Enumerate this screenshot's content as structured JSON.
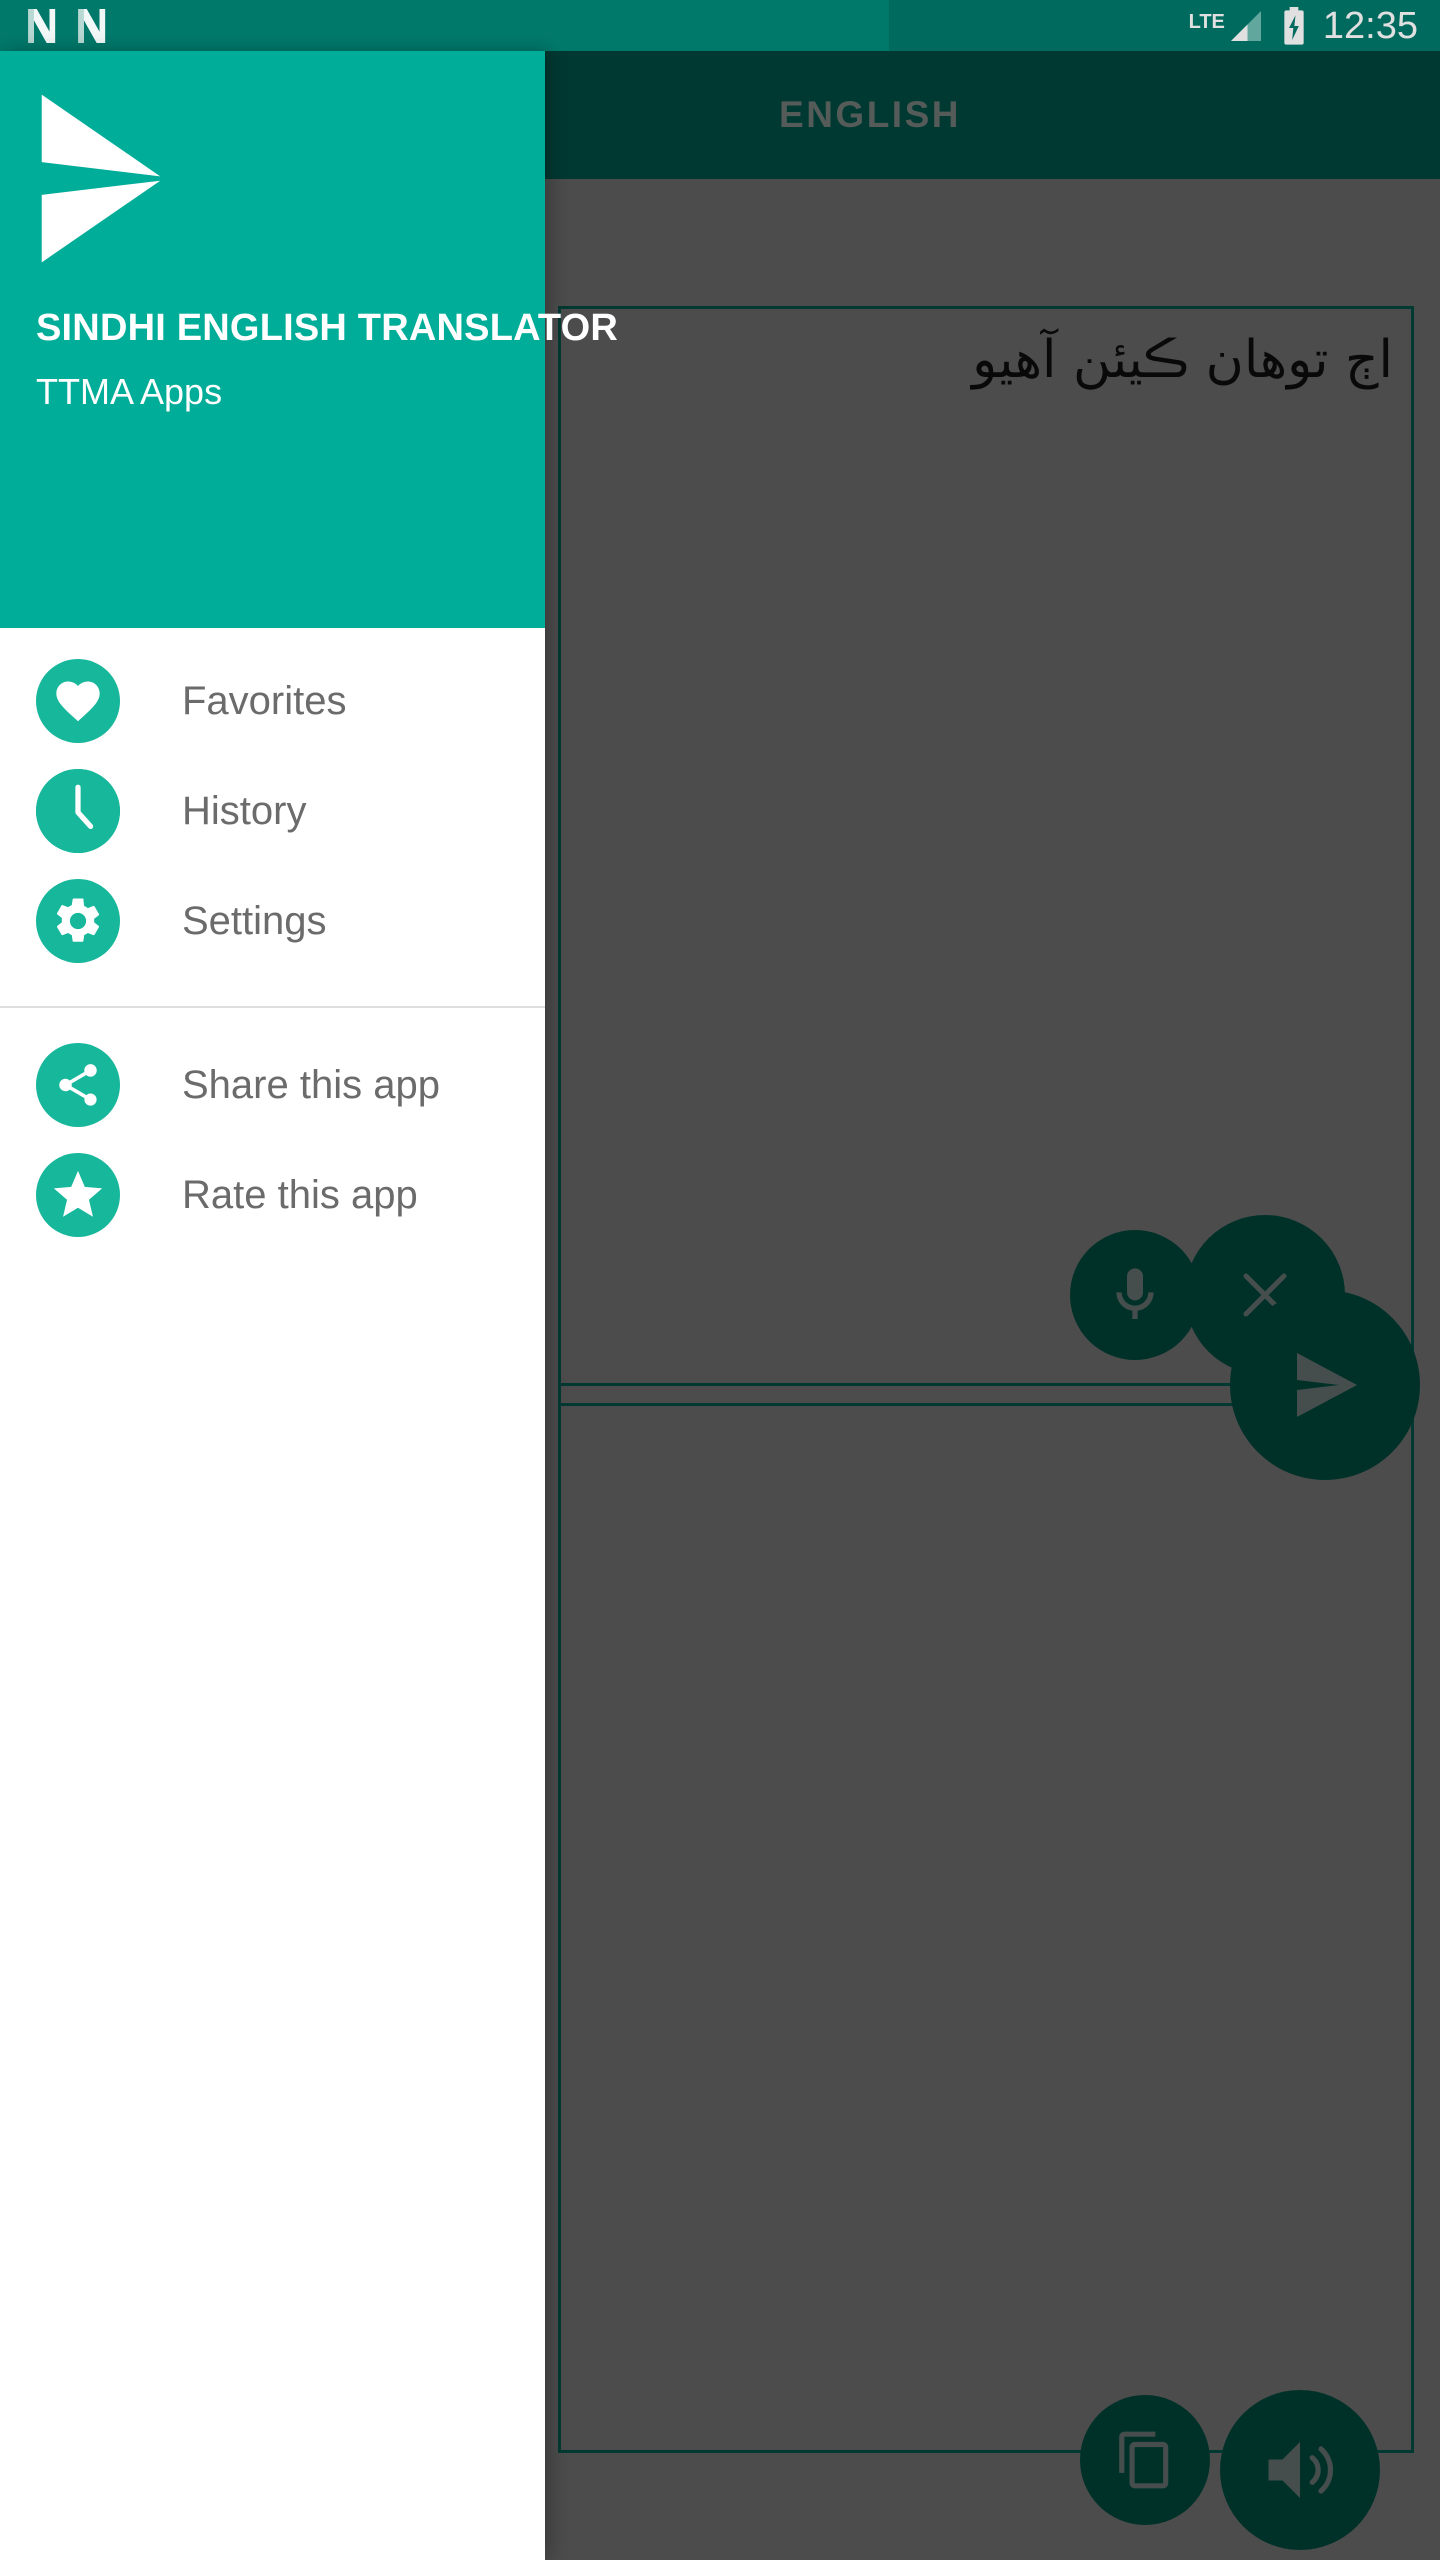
{
  "status_bar": {
    "icons": [
      "nova-launcher-icon",
      "nova-launcher-icon"
    ],
    "network_label": "LTE",
    "signal_icon": "signal-bars-icon",
    "battery_icon": "battery-charging-icon",
    "time": "12:35"
  },
  "app": {
    "toolbar": {
      "tab_label": "ENGLISH"
    },
    "input_box": {
      "text": "اڄ توهان ڪيئن آهيو"
    },
    "output_box": {
      "text": ""
    },
    "buttons": {
      "mic": "mic-icon",
      "clear": "close-x-icon",
      "send": "send-translate-icon",
      "copy": "copy-icon",
      "speak": "speaker-volume-icon"
    }
  },
  "drawer": {
    "logo": "paper-plane-send-logo",
    "title": "SINDHI ENGLISH TRANSLATOR",
    "subtitle": "TTMA Apps",
    "primary_items": [
      {
        "label": "Favorites",
        "icon": "heart-icon"
      },
      {
        "label": "History",
        "icon": "clock-icon"
      },
      {
        "label": "Settings",
        "icon": "gear-icon"
      }
    ],
    "secondary_items": [
      {
        "label": "Share this app",
        "icon": "share-icon"
      },
      {
        "label": "Rate this app",
        "icon": "star-icon"
      }
    ]
  },
  "colors": {
    "status_bar": "#00796B",
    "toolbar": "#00695C",
    "drawer_header": "#00AD98",
    "menu_icon_bg": "#16B79B",
    "fab": "#00594B",
    "accent_border": "#00695C",
    "menu_label": "#6b6b6b",
    "tab_inactive": "#9aa7a3"
  }
}
